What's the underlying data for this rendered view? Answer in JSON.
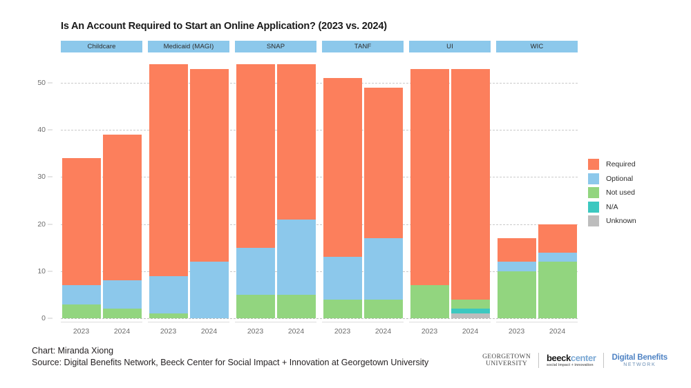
{
  "title": "Is An Account Required to Start an Online Application? (2023 vs. 2024)",
  "footer": {
    "chart_credit": "Chart: Miranda Xiong",
    "source": "Source: Digital Benefits Network, Beeck Center for Social Impact + Innovation at Georgetown University"
  },
  "logos": {
    "georgetown_line1": "GEORGETOWN",
    "georgetown_line2": "UNIVERSITY",
    "beeck_bold": "beeck",
    "beeck_light": "center",
    "beeck_sub": "social impact + innovation",
    "dbn_line1": "Digital Benefits",
    "dbn_line2": "NETWORK"
  },
  "colors": {
    "required": "#FC7F5C",
    "optional": "#8CC8EB",
    "not_used": "#92D57F",
    "na": "#3CC8C0",
    "unknown": "#BDBDBD",
    "header_band": "#8CC8EB",
    "gridline": "#C9C9C9"
  },
  "chart_data": {
    "type": "bar",
    "title": "Is An Account Required to Start an Online Application? (2023 vs. 2024)",
    "xlabel": "",
    "ylabel": "",
    "ylim": [
      0,
      55
    ],
    "yticks": [
      0,
      10,
      20,
      30,
      40,
      50
    ],
    "grid": true,
    "stacked": true,
    "legend_position": "right",
    "legend": [
      "Required",
      "Optional",
      "Not used",
      "N/A",
      "Unknown"
    ],
    "groups": [
      "Childcare",
      "Medicaid (MAGI)",
      "SNAP",
      "TANF",
      "UI",
      "WIC"
    ],
    "categories": [
      "2023",
      "2024"
    ],
    "series": [
      {
        "name": "Required",
        "color": "#FC7F5C",
        "values": {
          "Childcare": {
            "2023": 27,
            "2024": 31
          },
          "Medicaid (MAGI)": {
            "2023": 45,
            "2024": 41
          },
          "SNAP": {
            "2023": 39,
            "2024": 33
          },
          "TANF": {
            "2023": 38,
            "2024": 32
          },
          "UI": {
            "2023": 46,
            "2024": 49
          },
          "WIC": {
            "2023": 5,
            "2024": 6
          }
        }
      },
      {
        "name": "Optional",
        "color": "#8CC8EB",
        "values": {
          "Childcare": {
            "2023": 4,
            "2024": 6
          },
          "Medicaid (MAGI)": {
            "2023": 8,
            "2024": 12
          },
          "SNAP": {
            "2023": 10,
            "2024": 16
          },
          "TANF": {
            "2023": 9,
            "2024": 13
          },
          "UI": {
            "2023": 0,
            "2024": 0
          },
          "WIC": {
            "2023": 2,
            "2024": 2
          }
        }
      },
      {
        "name": "Not used",
        "color": "#92D57F",
        "values": {
          "Childcare": {
            "2023": 3,
            "2024": 2
          },
          "Medicaid (MAGI)": {
            "2023": 1,
            "2024": 0
          },
          "SNAP": {
            "2023": 5,
            "2024": 5
          },
          "TANF": {
            "2023": 4,
            "2024": 4
          },
          "UI": {
            "2023": 7,
            "2024": 2
          },
          "WIC": {
            "2023": 10,
            "2024": 12
          }
        }
      },
      {
        "name": "N/A",
        "color": "#3CC8C0",
        "values": {
          "Childcare": {
            "2023": 0,
            "2024": 0
          },
          "Medicaid (MAGI)": {
            "2023": 0,
            "2024": 0
          },
          "SNAP": {
            "2023": 0,
            "2024": 0
          },
          "TANF": {
            "2023": 0,
            "2024": 0
          },
          "UI": {
            "2023": 0,
            "2024": 1
          },
          "WIC": {
            "2023": 0,
            "2024": 0
          }
        }
      },
      {
        "name": "Unknown",
        "color": "#BDBDBD",
        "values": {
          "Childcare": {
            "2023": 0,
            "2024": 0
          },
          "Medicaid (MAGI)": {
            "2023": 0,
            "2024": 0
          },
          "SNAP": {
            "2023": 0,
            "2024": 0
          },
          "TANF": {
            "2023": 0,
            "2024": 0
          },
          "UI": {
            "2023": 0,
            "2024": 1
          },
          "WIC": {
            "2023": 0,
            "2024": 0
          }
        }
      }
    ],
    "totals": {
      "Childcare": {
        "2023": 34,
        "2024": 39
      },
      "Medicaid (MAGI)": {
        "2023": 54,
        "2024": 53
      },
      "SNAP": {
        "2023": 54,
        "2024": 54
      },
      "TANF": {
        "2023": 51,
        "2024": 49
      },
      "UI": {
        "2023": 53,
        "2024": 53
      },
      "WIC": {
        "2023": 17,
        "2024": 20
      }
    }
  }
}
